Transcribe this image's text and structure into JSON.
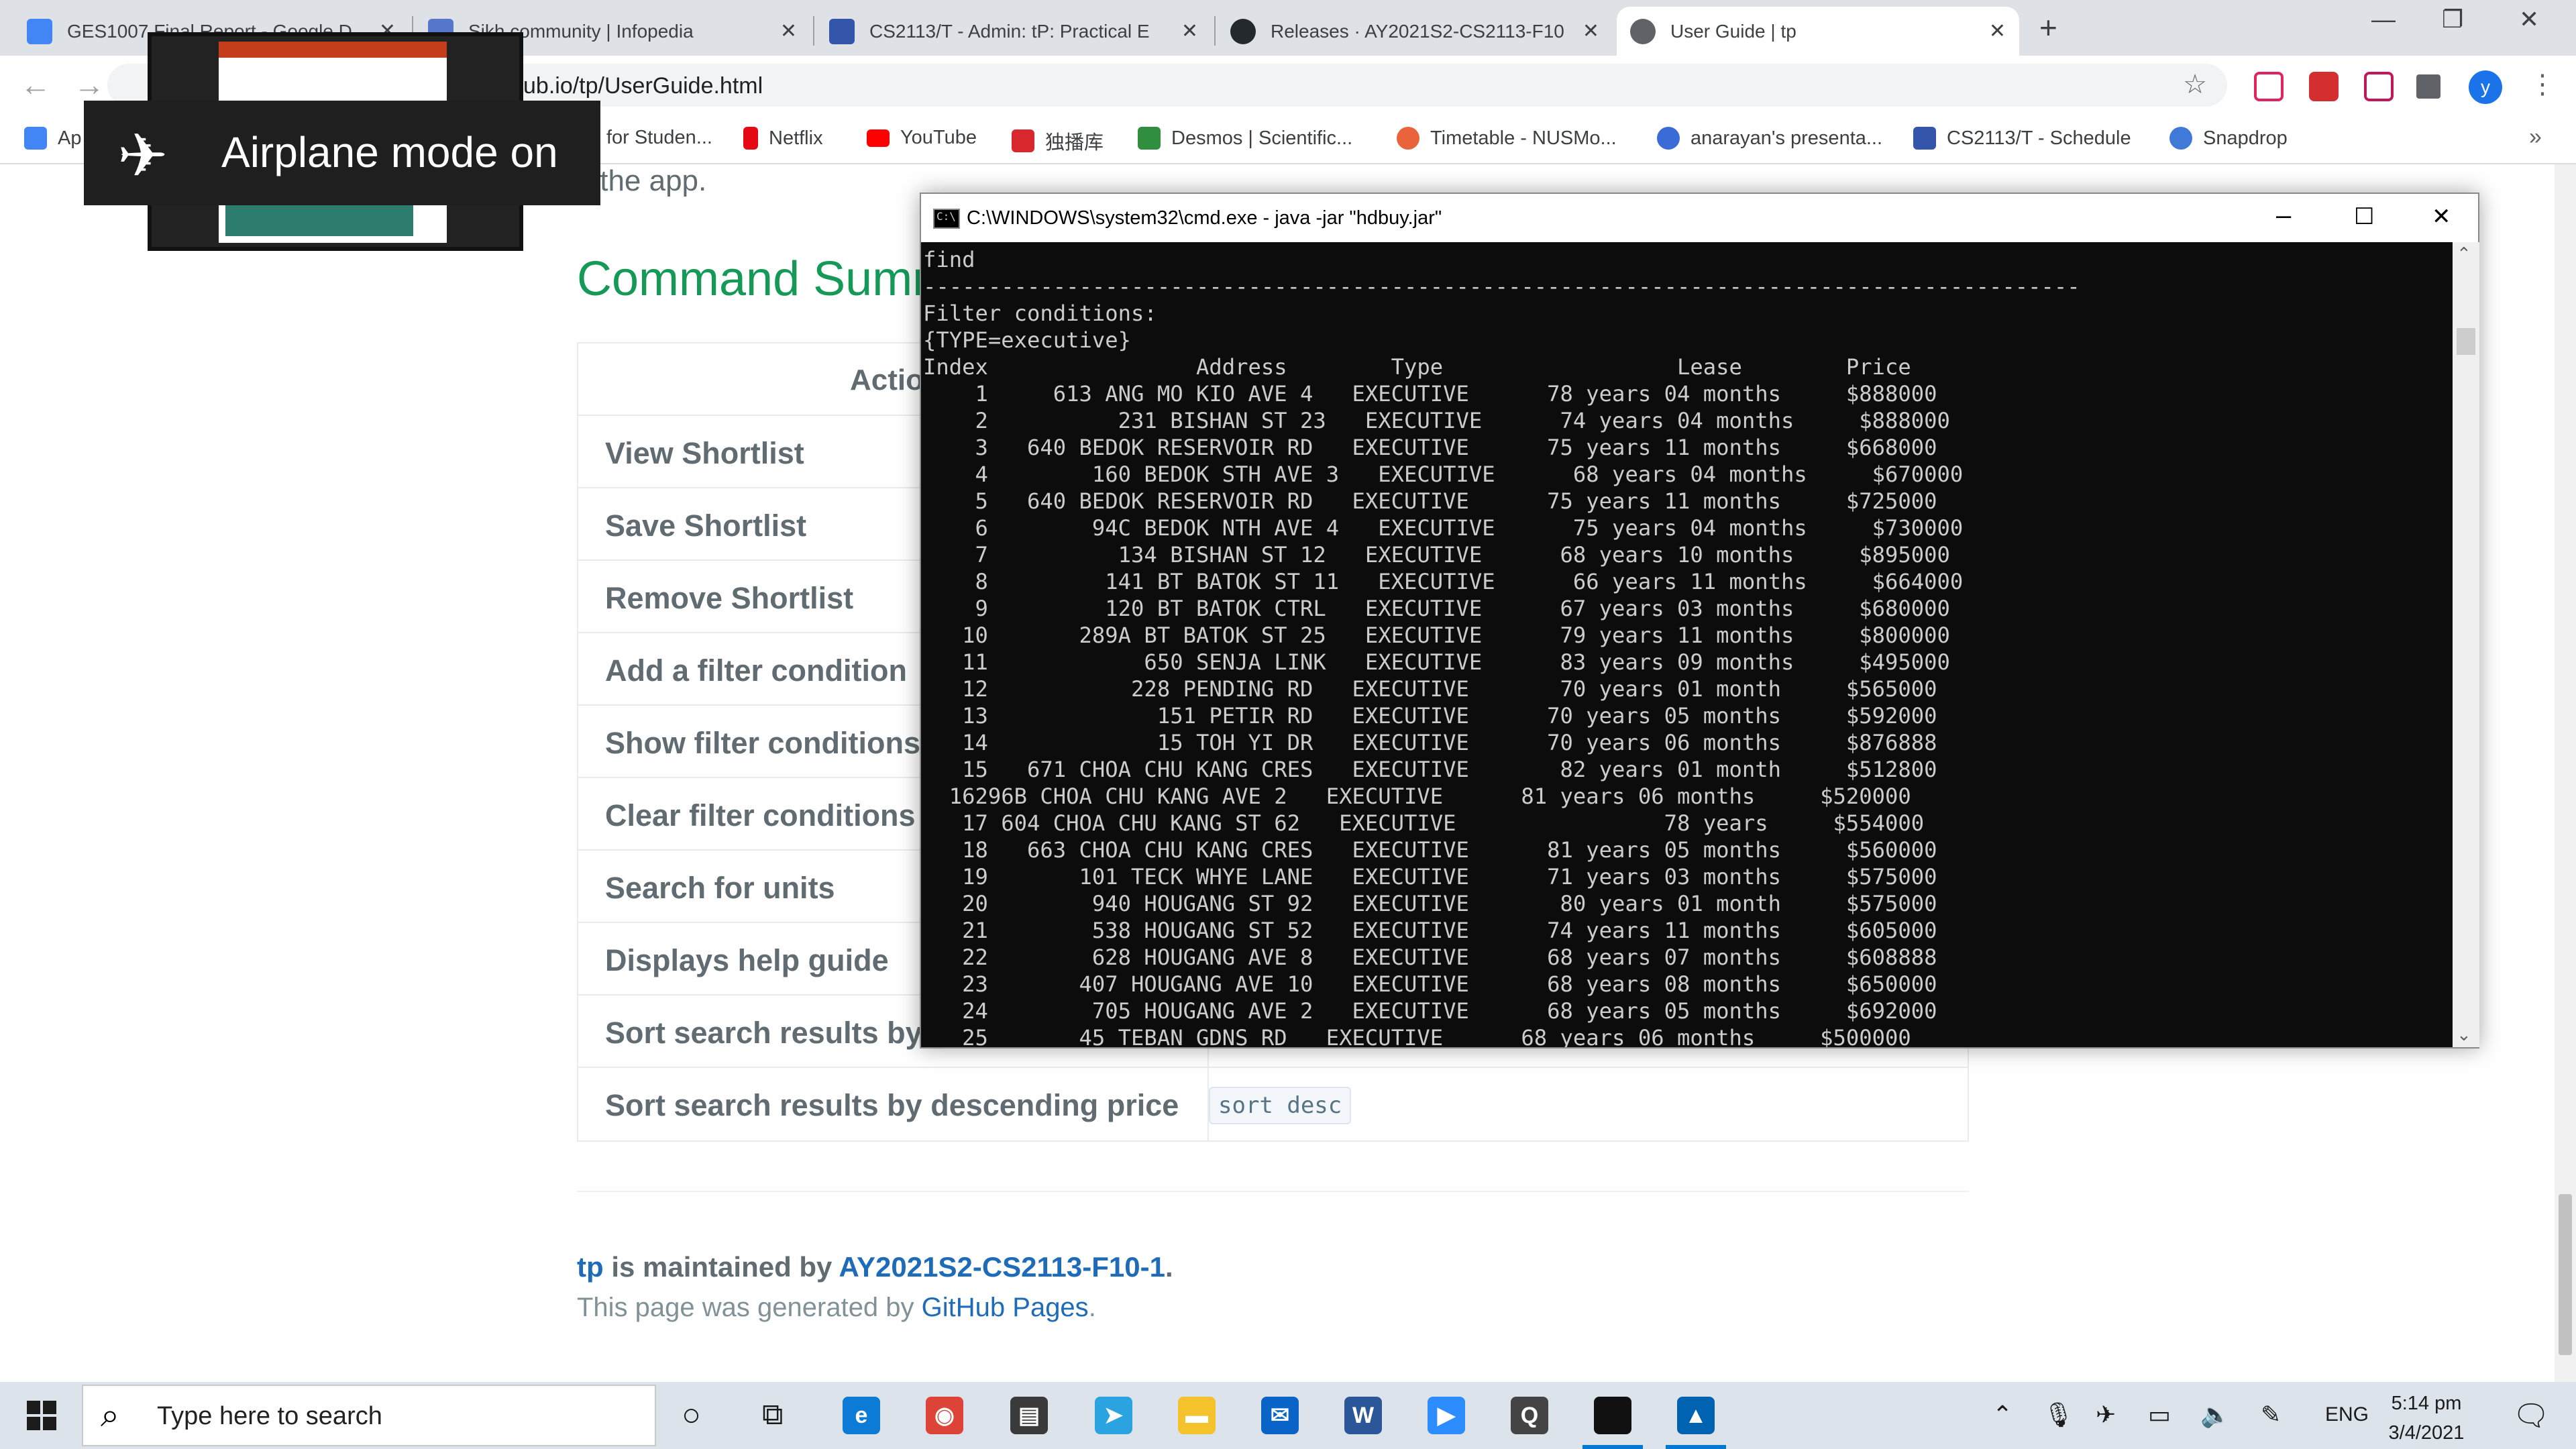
{
  "browser": {
    "tabs": [
      {
        "title": "GES1007 Final Report - Google D",
        "icon_color": "#4285f4"
      },
      {
        "title": "Sikh community | Infopedia",
        "icon_color": "#5577cc"
      },
      {
        "title": "CS2113/T - Admin: tP: Practical E",
        "icon_color": "#3355aa"
      },
      {
        "title": "Releases · AY2021S2-CS2113-F10",
        "icon_color": "#24292e"
      },
      {
        "title": "User Guide | tp",
        "icon_color": "#5f6368"
      }
    ],
    "new_tab": "+",
    "url": "ub.io/tp/UserGuide.html",
    "avatar_letter": "y",
    "bookmarks": [
      {
        "label": "Ap",
        "color": "#4285f4"
      },
      {
        "label": "for Studen...",
        "color": "#ffffff"
      },
      {
        "label": "Netflix",
        "color": "#e50914"
      },
      {
        "label": "YouTube",
        "color": "#ff0000"
      },
      {
        "label": "独播库",
        "color": "#d9272e"
      },
      {
        "label": "Desmos | Scientific...",
        "color": "#2f8f3f"
      },
      {
        "label": "Timetable - NUSMo...",
        "color": "#e9633b"
      },
      {
        "label": "anarayan's presenta...",
        "color": "#3a6bd6"
      },
      {
        "label": "CS2113/T - Schedule",
        "color": "#3355aa"
      },
      {
        "label": "Snapdrop",
        "color": "#3f7ad9"
      }
    ],
    "bookmarks_more": "»"
  },
  "page": {
    "prev_text": "s the app.",
    "section_title": "Command Summ",
    "table_header": "Actio",
    "rows": [
      {
        "action": "View Shortlist",
        "format": ""
      },
      {
        "action": "Save Shortlist",
        "format": ""
      },
      {
        "action": "Remove Shortlist",
        "format": ""
      },
      {
        "action": "Add a filter condition",
        "format": ""
      },
      {
        "action": "Show filter conditions",
        "format": ""
      },
      {
        "action": "Clear filter conditions",
        "format": ""
      },
      {
        "action": "Search for units",
        "format": ""
      },
      {
        "action": "Displays help guide",
        "format": ""
      },
      {
        "action": "Sort search results by",
        "format": ""
      },
      {
        "action": "Sort search results by descending price",
        "format": "sort desc"
      }
    ],
    "footer": {
      "maint_prefix": "tp",
      "maint_middle": " is maintained by ",
      "maint_link": "AY2021S2-CS2113-F10-1",
      "maint_suffix": ".",
      "gen_prefix": "This page was generated by ",
      "gen_link": "GitHub Pages",
      "gen_suffix": "."
    }
  },
  "cmd": {
    "title": "C:\\WINDOWS\\system32\\cmd.exe - java  -jar \"hdbuy.jar\"",
    "icon_text": "C:\\",
    "lines": [
      "find",
      "-----------------------------------------------------------------------------------------",
      "Filter conditions:",
      "{TYPE=executive}",
      "Index                Address        Type                  Lease        Price",
      "    1     613 ANG MO KIO AVE 4   EXECUTIVE      78 years 04 months     $888000",
      "    2          231 BISHAN ST 23   EXECUTIVE      74 years 04 months     $888000",
      "    3   640 BEDOK RESERVOIR RD   EXECUTIVE      75 years 11 months     $668000",
      "    4        160 BEDOK STH AVE 3   EXECUTIVE      68 years 04 months     $670000",
      "    5   640 BEDOK RESERVOIR RD   EXECUTIVE      75 years 11 months     $725000",
      "    6        94C BEDOK NTH AVE 4   EXECUTIVE      75 years 04 months     $730000",
      "    7          134 BISHAN ST 12   EXECUTIVE      68 years 10 months     $895000",
      "    8         141 BT BATOK ST 11   EXECUTIVE      66 years 11 months     $664000",
      "    9         120 BT BATOK CTRL   EXECUTIVE      67 years 03 months     $680000",
      "   10       289A BT BATOK ST 25   EXECUTIVE      79 years 11 months     $800000",
      "   11            650 SENJA LINK   EXECUTIVE      83 years 09 months     $495000",
      "   12           228 PENDING RD   EXECUTIVE       70 years 01 month     $565000",
      "   13             151 PETIR RD   EXECUTIVE      70 years 05 months     $592000",
      "   14             15 TOH YI DR   EXECUTIVE      70 years 06 months     $876888",
      "   15   671 CHOA CHU KANG CRES   EXECUTIVE       82 years 01 month     $512800",
      "  16296B CHOA CHU KANG AVE 2   EXECUTIVE      81 years 06 months     $520000",
      "   17 604 CHOA CHU KANG ST 62   EXECUTIVE                78 years     $554000",
      "   18   663 CHOA CHU KANG CRES   EXECUTIVE      81 years 05 months     $560000",
      "   19       101 TECK WHYE LANE   EXECUTIVE      71 years 03 months     $575000",
      "   20        940 HOUGANG ST 92   EXECUTIVE       80 years 01 month     $575000",
      "   21        538 HOUGANG ST 52   EXECUTIVE      74 years 11 months     $605000",
      "   22        628 HOUGANG AVE 8   EXECUTIVE      68 years 07 months     $608888",
      "   23       407 HOUGANG AVE 10   EXECUTIVE      68 years 08 months     $650000",
      "   24        705 HOUGANG AVE 2   EXECUTIVE      68 years 05 months     $692000",
      "   25       45 TEBAN GDNS RD   EXECUTIVE      68 years 06 months     $500000"
    ]
  },
  "overlay": {
    "airplane_text": "Airplane mode on"
  },
  "taskbar": {
    "search_placeholder": "Type here to search",
    "language": "ENG",
    "time": "5:14 pm",
    "date": "3/4/2021",
    "apps": [
      {
        "name": "edge",
        "color": "#0c7bd6",
        "glyph": "e"
      },
      {
        "name": "chrome",
        "color": "#db4437",
        "glyph": "◉"
      },
      {
        "name": "store",
        "color": "#3a3a3a",
        "glyph": "▤"
      },
      {
        "name": "telegram",
        "color": "#2aa3e0",
        "glyph": "➤"
      },
      {
        "name": "file-explorer",
        "color": "#f4c22b",
        "glyph": "▬"
      },
      {
        "name": "mail",
        "color": "#0a64c8",
        "glyph": "✉"
      },
      {
        "name": "word",
        "color": "#2b579a",
        "glyph": "W"
      },
      {
        "name": "zoom",
        "color": "#2d8cff",
        "glyph": "▶"
      },
      {
        "name": "search-app",
        "color": "#444444",
        "glyph": "Q"
      },
      {
        "name": "cmd",
        "color": "#111111",
        "glyph": ""
      },
      {
        "name": "photos",
        "color": "#0063b1",
        "glyph": "▲"
      }
    ]
  }
}
